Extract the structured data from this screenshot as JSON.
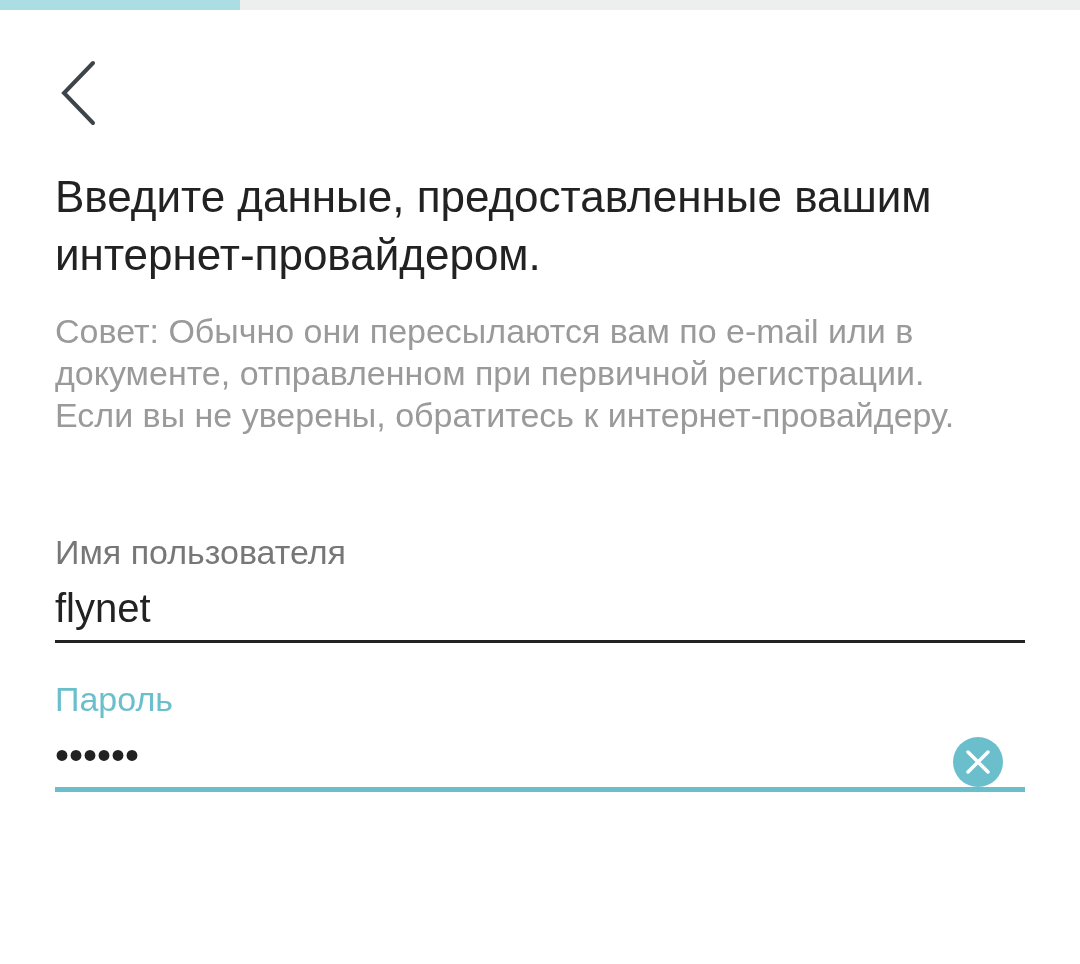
{
  "progress": {
    "level": 0.222
  },
  "title": "Введите данные, предоставленные вашим интернет-провайдером.",
  "hint": "Совет: Обычно они пересылаются вам по e-mail или в документе, отправленном при первичной регистрации. Если вы не уверены, обратитесь к интернет-провайдеру.",
  "fields": [
    {
      "label": "Имя пользователя",
      "value": "flynet",
      "focused": false,
      "clearable": false
    },
    {
      "label": "Пароль",
      "value": "••••••",
      "focused": true,
      "clearable": true
    }
  ]
}
